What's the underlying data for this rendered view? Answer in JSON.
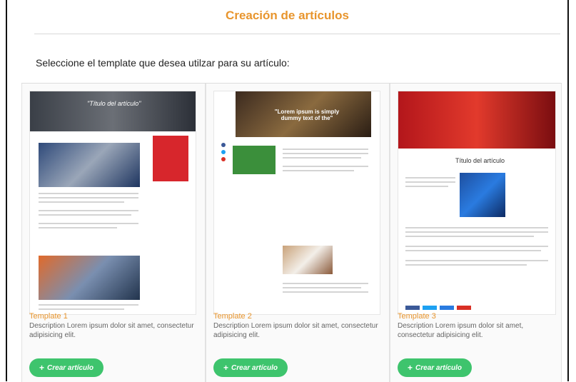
{
  "page": {
    "title": "Creación de artículos",
    "subtitle": "Seleccione el template que desea utilzar para su artículo:"
  },
  "templates": [
    {
      "preview_title": "\"Título del artículo\"",
      "name": "Template 1",
      "description": "Description Lorem ipsum dolor sit amet, consectetur adipisicing elit.",
      "button": "Crear artículo"
    },
    {
      "preview_title": "\"Lorem ipsum is simply dummy text of the\"",
      "name": "Template 2",
      "description": "Description Lorem ipsum dolor sit amet, consectetur adipisicing elit.",
      "button": "Crear artículo"
    },
    {
      "preview_title": "Título del artículo",
      "name": "Template 3",
      "description": "Description Lorem ipsum dolor sit amet, consectetur adipisicing elit.",
      "button": "Crear artículo"
    }
  ],
  "colors": {
    "accent": "#e8952d",
    "button": "#3ec46d"
  },
  "icons": {
    "button_icon": "plus-icon"
  }
}
